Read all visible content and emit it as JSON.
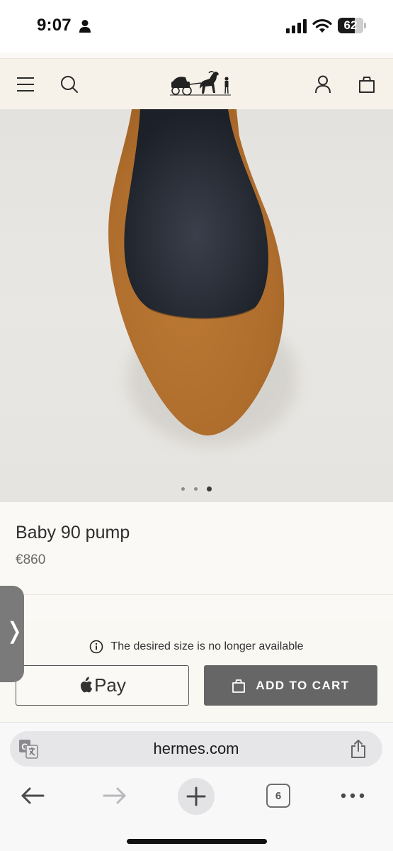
{
  "status_bar": {
    "time": "9:07",
    "battery_level": "62",
    "icons": [
      "person-icon",
      "signal-icon",
      "wifi-icon",
      "battery-icon"
    ]
  },
  "header": {
    "icons": [
      "menu-icon",
      "search-icon",
      "hermes-carriage-logo",
      "account-icon",
      "shopping-bag-icon"
    ]
  },
  "product": {
    "name": "Baby 90 pump",
    "price": "€860",
    "carousel": {
      "total": 3,
      "active_index": 3
    },
    "colors": {
      "suede": "#b0702f",
      "lining": "#2a2f3a"
    }
  },
  "purchase": {
    "availability_message": "The desired size is no longer available",
    "apple_pay_label": "Pay",
    "add_to_cart_label": "ADD TO CART",
    "button_color": "#666666"
  },
  "browser": {
    "url": "hermes.com",
    "tab_count": "6",
    "icons": [
      "translate-icon",
      "share-icon",
      "back-arrow-icon",
      "forward-arrow-icon",
      "plus-icon",
      "tabs-icon",
      "more-icon"
    ]
  }
}
